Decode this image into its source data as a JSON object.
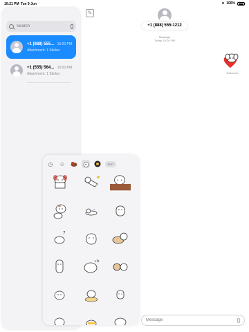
{
  "status_bar": {
    "time": "10:21 PM",
    "date": "Tue 9 Jun",
    "battery": "100%"
  },
  "sidebar": {
    "search_placeholder": "Search",
    "conversations": [
      {
        "name": "+1 (888) 555...",
        "time": "10:20 PM",
        "preview": "Attachment: 1 Sticker",
        "selected": true
      },
      {
        "name": "+1 (555) 564...",
        "time": "10:20 PM",
        "preview": "Attachment: 1 Sticker",
        "selected": false
      }
    ]
  },
  "conversation": {
    "contact": "+1 (888) 555-1212",
    "service_label": "Message",
    "timestamp": "Today, 10:20 PM",
    "status": "Delivered",
    "input_placeholder": "Message"
  },
  "sticker_drawer": {
    "tabs": [
      "recents-icon",
      "emoji-icon",
      "sticker-pack-brown-icon",
      "sticker-pack-dog-icon",
      "sticker-pack-black-icon"
    ],
    "edit_label": "EDIT",
    "stickers": [
      "dog-peeking",
      "dog-sleeping",
      "dog-on-wall",
      "dog-pointing",
      "dog-lying",
      "dog-standing",
      "dog-question",
      "dog-sitting",
      "dog-curled",
      "dog-tall",
      "dog-round",
      "dog-pair",
      "dog-walking",
      "dog-bowl",
      "dog-wave",
      "dog-bottom-1",
      "dog-bottom-2",
      "dog-bottom-3"
    ]
  },
  "colors": {
    "accent": "#1a8cff",
    "sidebar_bg": "#f3f3f5",
    "heart": "#e8312a"
  }
}
